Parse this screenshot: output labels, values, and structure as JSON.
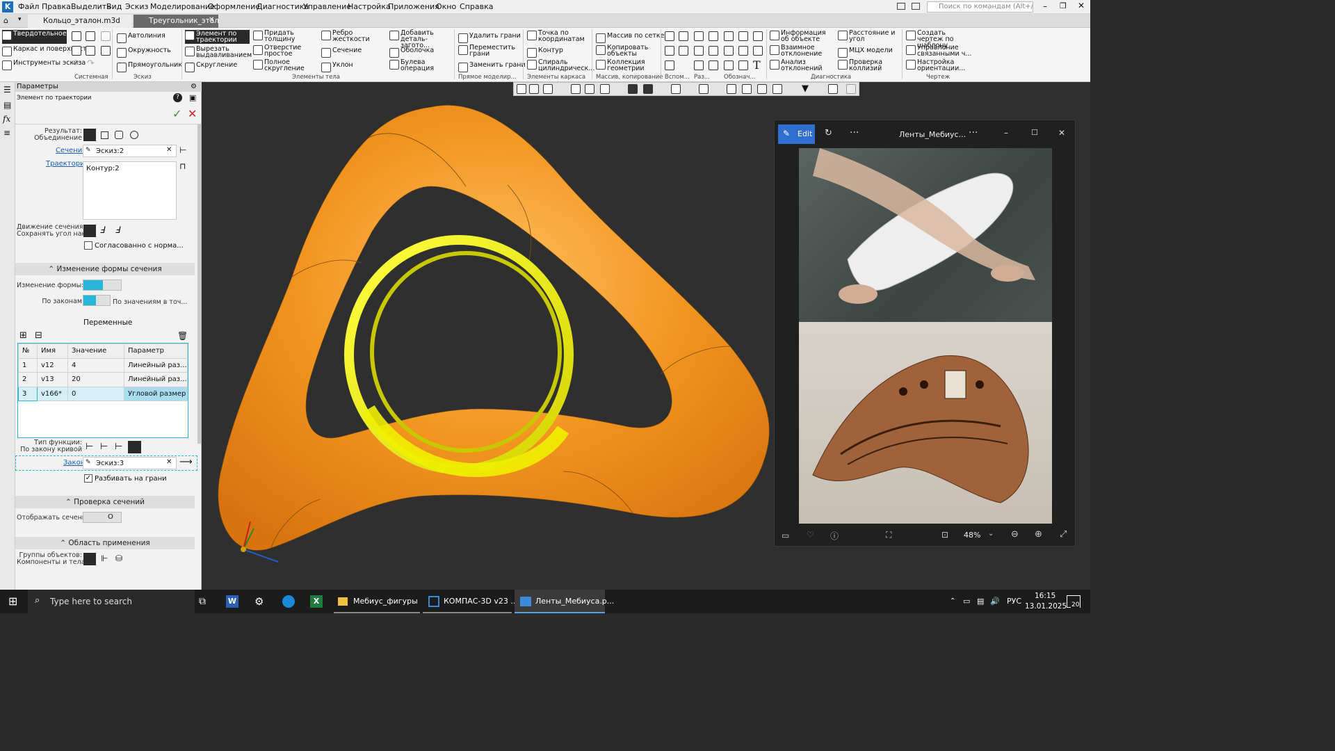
{
  "menubar": {
    "items": [
      "Файл",
      "Правка",
      "Выделить",
      "Вид",
      "Эскиз",
      "Моделирование",
      "Оформление",
      "Диагностика",
      "Управление",
      "Настройка",
      "Приложения",
      "Окно",
      "Справка"
    ],
    "search_placeholder": "Поиск по командам (Alt+/)"
  },
  "tabs": {
    "tab1": "Кольцо_эталон.m3d",
    "tab2": "Треугольник_этало..."
  },
  "ribbon": {
    "mode": [
      "Твердотельное моделирование",
      "Каркас и поверхности",
      "Инструменты эскиза"
    ],
    "sketch": [
      "Автолиния",
      "Окружность",
      "Прямоугольник"
    ],
    "body": [
      "Элемент по траектории",
      "Вырезать выдавливанием",
      "Скругление",
      "Придать толщину",
      "Отверстие простое",
      "Полное скругление",
      "Ребро жесткости",
      "Сечение",
      "Уклон",
      "Добавить деталь-загото...",
      "Оболочка",
      "Булева операция"
    ],
    "direct": [
      "Удалить грани",
      "Переместить грани",
      "Заменить грани"
    ],
    "frame": [
      "Точка по координатам",
      "Контур",
      "Спираль цилиндрическ..."
    ],
    "array": [
      "Массив по сетке",
      "Копировать объекты",
      "Коллекция геометрии"
    ],
    "diag": [
      "Информация об объекте",
      "Взаимное отклонение",
      "Анализ отклонений",
      "Расстояние и угол",
      "МЦХ модели",
      "Проверка коллизий"
    ],
    "drawing": [
      "Создать чертеж по шаблону",
      "Управление связанными ч...",
      "Настройка ориентации..."
    ],
    "groups": [
      "Системная",
      "Эскиз",
      "Элементы тела",
      "Прямое моделир...",
      "Элементы каркаса",
      "Массив, копирование",
      "Вспом...",
      "Раз...",
      "Обознач...",
      "Диагностика",
      "Чертеж"
    ]
  },
  "panel": {
    "header": "Параметры",
    "subtitle": "Элемент по траектории",
    "result_label": "Результат:",
    "union_label": "Объединение",
    "section_link": "Сечение",
    "section_value": "Эскиз:2",
    "trajectory_link": "Траектория",
    "trajectory_value": "Контур:2",
    "motion_label": "Движение сечения:",
    "motion_sub": "Сохранять угол нак...",
    "normal_check": "Согласованно с норма...",
    "shape_section": "Изменение формы сечения",
    "shape_change_label": "Изменение формы:",
    "laws_left": "По законам",
    "laws_right": "По значениям в точ...",
    "vars_title": "Переменные",
    "vars_cols": [
      "№",
      "Имя",
      "Значение",
      "Параметр"
    ],
    "vars_rows": [
      [
        "1",
        "v12",
        "4",
        "Линейный раз..."
      ],
      [
        "2",
        "v13",
        "20",
        "Линейный раз..."
      ],
      [
        "3",
        "v166*",
        "0",
        "Угловой размер"
      ]
    ],
    "func_type": "Тип функции:",
    "func_sub": "По закону кривой",
    "law_link": "Закон",
    "law_value": "Эскиз:3",
    "split_check": "Разбивать на грани",
    "check_section": "Проверка сечений",
    "show_sections": "Отображать сечения:",
    "area_section": "Область применения",
    "groups_label": "Группы объектов:",
    "groups_sub": "Компоненты и тела"
  },
  "photos": {
    "edit": "Edit",
    "title": "Ленты_Мебиус...",
    "zoom": "48%"
  },
  "taskbar": {
    "search": "Type here to search",
    "app1": "Мебиус_фигуры",
    "app2": "КОМПАС-3D v23 ...",
    "app3": "Ленты_Мебиуса.р...",
    "lang": "РУС",
    "time": "16:15",
    "date": "13.01.2025",
    "notif": "20"
  },
  "colors": {
    "accent": "#29b7d9",
    "orange": "#f0961e",
    "yellow": "#e8e800"
  }
}
